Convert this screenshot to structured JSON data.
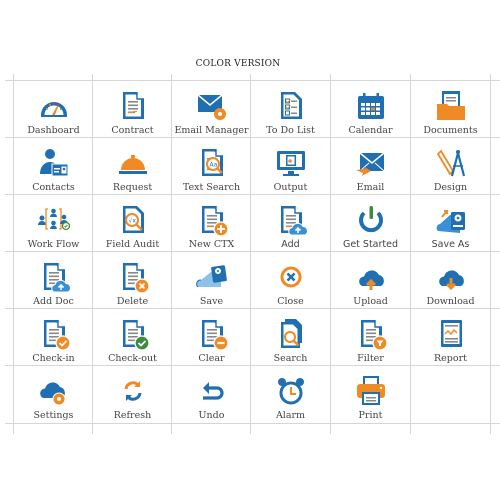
{
  "title": "COLOR VERSION",
  "colors": {
    "blue": "#1f6fb2",
    "orange": "#f08a24",
    "green": "#3d8b3d",
    "grid": "#d6d6d6"
  },
  "icons": [
    {
      "label": "Dashboard",
      "icon": "dashboard-gauge-icon"
    },
    {
      "label": "Contract",
      "icon": "contract-document-icon"
    },
    {
      "label": "Email Manager",
      "icon": "email-manager-gear-icon"
    },
    {
      "label": "To Do List",
      "icon": "todo-list-icon"
    },
    {
      "label": "Calendar",
      "icon": "calendar-icon"
    },
    {
      "label": "Documents",
      "icon": "documents-folder-icon"
    },
    {
      "label": "Contacts",
      "icon": "contacts-person-card-icon"
    },
    {
      "label": "Request",
      "icon": "service-bell-icon"
    },
    {
      "label": "Text Search",
      "icon": "text-search-icon"
    },
    {
      "label": "Output",
      "icon": "monitor-output-icon"
    },
    {
      "label": "Email",
      "icon": "email-send-icon"
    },
    {
      "label": "Design",
      "icon": "ruler-compass-icon"
    },
    {
      "label": "Work Flow",
      "icon": "workflow-people-icon"
    },
    {
      "label": "Field Audit",
      "icon": "field-audit-icon"
    },
    {
      "label": "New CTX",
      "icon": "new-document-plus-icon"
    },
    {
      "label": "Add",
      "icon": "add-document-cloud-icon"
    },
    {
      "label": "Get Started",
      "icon": "power-icon"
    },
    {
      "label": "Save As",
      "icon": "save-as-drive-icon"
    },
    {
      "label": "Add Doc",
      "icon": "add-doc-cloud-upload-icon"
    },
    {
      "label": "Delete",
      "icon": "delete-document-icon"
    },
    {
      "label": "Save",
      "icon": "save-cloud-drive-icon"
    },
    {
      "label": "Close",
      "icon": "close-circle-icon"
    },
    {
      "label": "Upload",
      "icon": "cloud-upload-icon"
    },
    {
      "label": "Download",
      "icon": "cloud-download-icon"
    },
    {
      "label": "Check-in",
      "icon": "check-in-document-icon"
    },
    {
      "label": "Check-out",
      "icon": "check-out-document-icon"
    },
    {
      "label": "Clear",
      "icon": "clear-document-icon"
    },
    {
      "label": "Search",
      "icon": "search-documents-icon"
    },
    {
      "label": "Filter",
      "icon": "filter-document-icon"
    },
    {
      "label": "Report",
      "icon": "report-chart-icon"
    },
    {
      "label": "Settings",
      "icon": "cloud-settings-icon"
    },
    {
      "label": "Refresh",
      "icon": "refresh-icon"
    },
    {
      "label": "Undo",
      "icon": "undo-icon"
    },
    {
      "label": "Alarm",
      "icon": "alarm-clock-icon"
    },
    {
      "label": "Print",
      "icon": "printer-icon"
    }
  ]
}
